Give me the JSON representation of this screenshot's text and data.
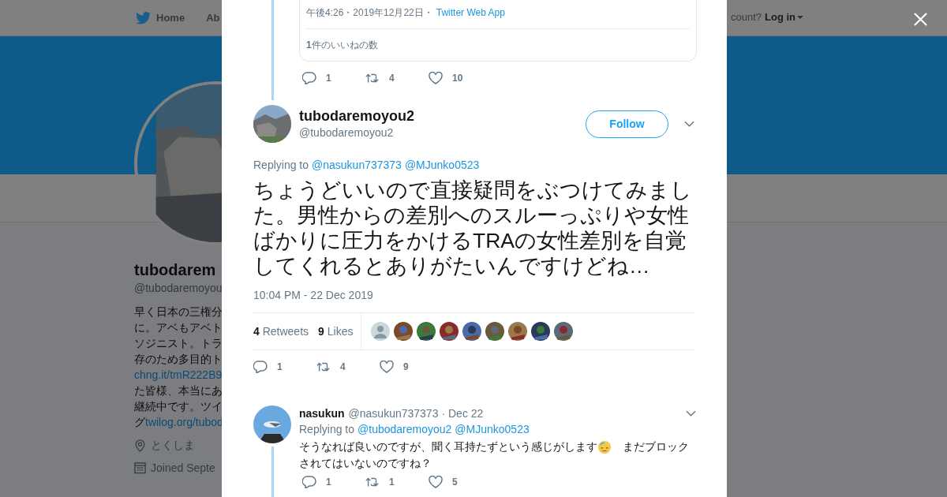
{
  "nav": {
    "items": [
      {
        "label": "Home"
      },
      {
        "label": "Ab"
      }
    ],
    "account_prompt": "count?",
    "login": "Log in"
  },
  "profile": {
    "name": "tubodarem",
    "handle": "@tubodaremoyou",
    "bio": [
      {
        "text": "早く日本の三権分"
      },
      {
        "text": "に。アベもアベト"
      },
      {
        "text": "ソジニスト。トラ"
      },
      {
        "text": "存のため多目的ト"
      },
      {
        "link": "chng.it/tmR222B9"
      },
      {
        "text": "た皆様、本当にあ"
      },
      {
        "text": "継続中です。ツイ"
      },
      {
        "text": "グ",
        "link": "twilog.org/tubod"
      }
    ],
    "location": "とくしま",
    "joined": "Joined Septe"
  },
  "modal": {
    "quoted": {
      "meta": "午後4:26・2019年12月22日・",
      "source": "Twitter Web App",
      "likes": "**1**件のいいねの数"
    },
    "thread_actions": [
      {
        "kind": "reply",
        "count": "1"
      },
      {
        "kind": "retweet",
        "count": "4"
      },
      {
        "kind": "like",
        "count": "10"
      }
    ],
    "tweet": {
      "name": "tubodaremoyou2",
      "handle": "@tubodaremoyou2",
      "follow": "Follow",
      "replying_label": "Replying to",
      "replying_to": [
        "@nasukun737373",
        "@MJunko0523"
      ],
      "text": "ちょうどいいので直接疑問をぶつけてみました。男性からの差別へのスルーっぷりや女性ばかりに圧力をかけるTRAの女性差別を自覚してくれるとありがたいんですけどね…",
      "time": "10:04 PM - 22 Dec 2019",
      "stats": [
        {
          "count": "4",
          "label": "Retweets"
        },
        {
          "count": "9",
          "label": "Likes"
        }
      ],
      "likers": [
        {
          "kind": "default"
        },
        {
          "kind": "picture"
        },
        {
          "kind": "picture"
        },
        {
          "kind": "picture"
        },
        {
          "kind": "picture"
        },
        {
          "kind": "picture"
        },
        {
          "kind": "picture"
        },
        {
          "kind": "picture"
        },
        {
          "kind": "picture"
        }
      ],
      "actions": [
        {
          "kind": "reply",
          "count": "1"
        },
        {
          "kind": "retweet",
          "count": "4"
        },
        {
          "kind": "like",
          "count": "9"
        }
      ]
    },
    "reply": {
      "name": "nasukun",
      "handle": "@nasukun737373",
      "date": "· Dec 22",
      "replying_label": "Replying to",
      "replying_to": [
        "@tubodaremoyou2",
        "@MJunko0523"
      ],
      "text": [
        "そうなれば良いのですが、聞く耳持たずという感じがします",
        "まだブロック",
        "されてはいないのですね？"
      ],
      "actions": [
        {
          "kind": "reply",
          "count": "1"
        },
        {
          "kind": "retweet",
          "count": "1"
        },
        {
          "kind": "like",
          "count": "5"
        }
      ]
    }
  }
}
